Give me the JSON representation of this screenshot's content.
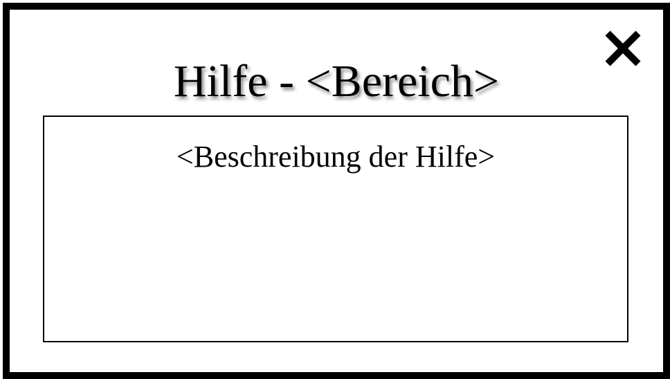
{
  "dialog": {
    "title": "Hilfe - <Bereich>",
    "description": "<Beschreibung der Hilfe>",
    "close_icon": "close-icon"
  }
}
